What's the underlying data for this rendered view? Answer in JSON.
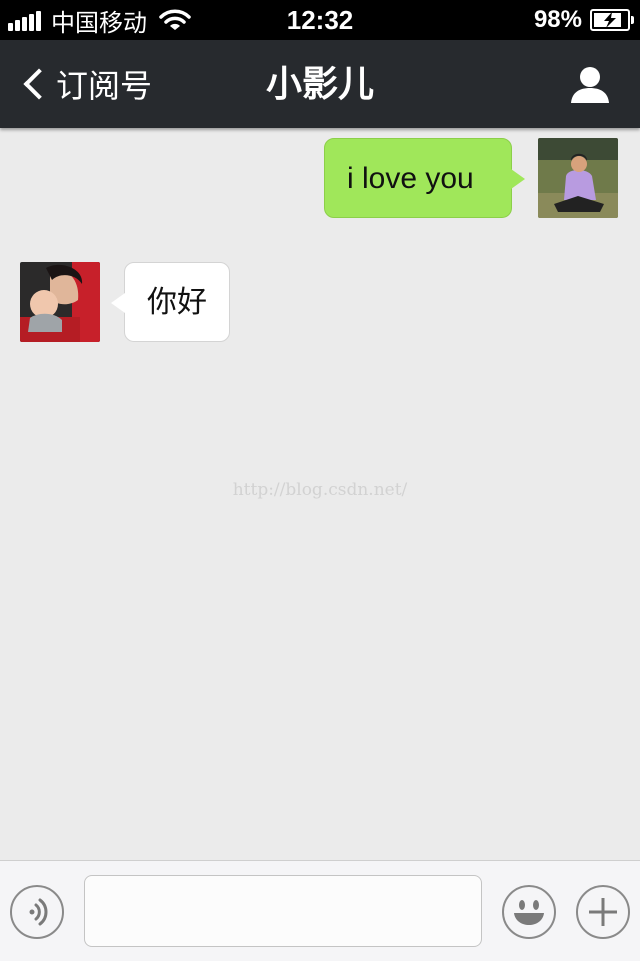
{
  "status_bar": {
    "carrier": "中国移动",
    "time": "12:32",
    "battery_percent": "98%",
    "battery_level": 0.98
  },
  "nav": {
    "back_label": "订阅号",
    "title": "小影儿",
    "profile_icon": "person-icon"
  },
  "messages": [
    {
      "direction": "outgoing",
      "text": "i love you"
    },
    {
      "direction": "incoming",
      "text": "你好"
    }
  ],
  "watermark": "http://blog.csdn.net/",
  "input_bar": {
    "voice_icon": "voice-icon",
    "text_value": "",
    "emoji_icon": "emoji-icon",
    "more_icon": "plus-icon"
  },
  "colors": {
    "outgoing_bubble": "#a0e75a",
    "incoming_bubble": "#ffffff",
    "nav_background": "#272a2e",
    "chat_background": "#ebebeb"
  }
}
